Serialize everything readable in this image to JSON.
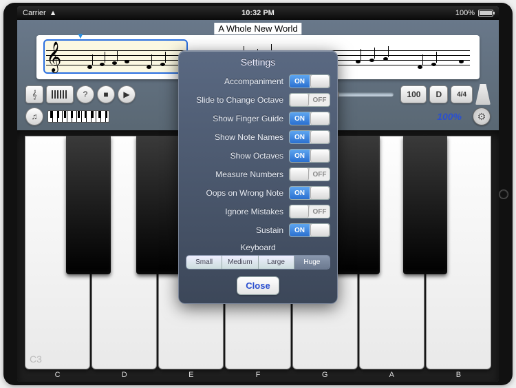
{
  "status": {
    "carrier": "Carrier",
    "time": "10:32 PM",
    "battery": "100%"
  },
  "song_title": "A Whole New World",
  "toolbar": {
    "tempo": "100",
    "key": "D",
    "time_sig": "4/4"
  },
  "secondrow": {
    "zoom": "100%"
  },
  "keyboard": {
    "octave_label": "C3",
    "notes": [
      "C",
      "D",
      "E",
      "F",
      "G",
      "A",
      "B"
    ]
  },
  "modal": {
    "title": "Settings",
    "rows": [
      {
        "label": "Accompaniment",
        "state": "on"
      },
      {
        "label": "Slide to Change Octave",
        "state": "off"
      },
      {
        "label": "Show Finger Guide",
        "state": "on"
      },
      {
        "label": "Show Note Names",
        "state": "on"
      },
      {
        "label": "Show Octaves",
        "state": "on"
      },
      {
        "label": "Measure Numbers",
        "state": "off"
      },
      {
        "label": "Oops on Wrong Note",
        "state": "on"
      },
      {
        "label": "Ignore Mistakes",
        "state": "off"
      },
      {
        "label": "Sustain",
        "state": "on"
      }
    ],
    "switch_on": "ON",
    "switch_off": "OFF",
    "keyboard_label": "Keyboard",
    "sizes": [
      "Small",
      "Medium",
      "Large",
      "Huge"
    ],
    "selected_size": 3,
    "close": "Close"
  }
}
